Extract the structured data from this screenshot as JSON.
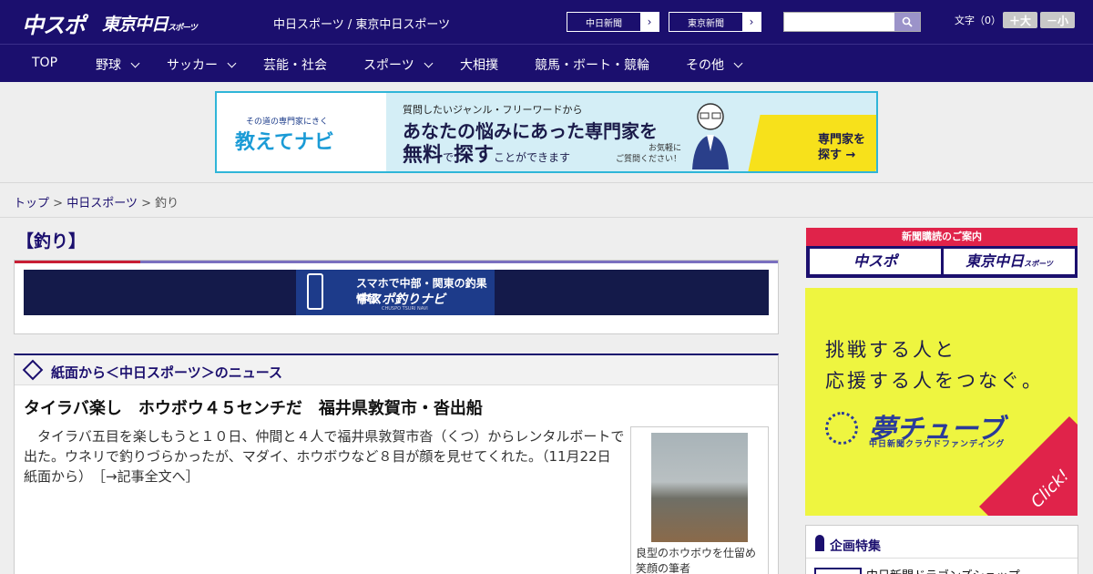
{
  "header": {
    "logo": "中スポ",
    "logo2": "東京中日",
    "logo2_suffix": "スポーツ",
    "tagline": "中日スポーツ / 東京中日スポーツ",
    "ext_links": [
      {
        "label": "中日新聞"
      },
      {
        "label": "東京新聞"
      }
    ],
    "search_placeholder": "",
    "fontsize_label": "文字（0）",
    "font_larger": "＋大",
    "font_smaller": "－小"
  },
  "nav": [
    {
      "label": "TOP",
      "has_menu": false
    },
    {
      "label": "野球",
      "has_menu": true
    },
    {
      "label": "サッカー",
      "has_menu": true
    },
    {
      "label": "芸能・社会",
      "has_menu": false
    },
    {
      "label": "スポーツ",
      "has_menu": true
    },
    {
      "label": "大相撲",
      "has_menu": false
    },
    {
      "label": "競馬・ボート・競輪",
      "has_menu": false
    },
    {
      "label": "その他",
      "has_menu": true
    }
  ],
  "top_ad": {
    "small": "その道の専門家にきく",
    "brand": "教えてナビ",
    "question": "質問したいジャンル・フリーワードから",
    "line1": "あなたの悩みにあった専門家を",
    "line2_a": "無料",
    "line2_b": "で",
    "line2_c": "探す",
    "line2_d": "ことができます",
    "note1": "お気軽に",
    "note2": "ご質問ください！",
    "cta1": "専門家を",
    "cta2": "探す →"
  },
  "breadcrumb": {
    "top": "トップ",
    "sep": ">",
    "section": "中日スポーツ",
    "current": "釣り"
  },
  "page_title": "【釣り】",
  "tsuri_ad": {
    "line1": "スマホで中部・関東の釣果情報",
    "line2": "中スポ釣りナビ",
    "line3": "CHUSPO TSURI NAVI"
  },
  "news": {
    "section_label": "紙面から＜中日スポーツ＞のニュース",
    "headline": "タイラバ楽し　ホウボウ４５センチだ　福井県敦賀市・沓出船",
    "body": "タイラバ五目を楽しもうと１０日、仲間と４人で福井県敦賀市沓（くつ）からレンタルボートで出た。ウネリで釣りづらかったが、マダイ、ホウボウなど８目が顔を見せてくれた。（11月22日 紙面から）",
    "more": "［→記事全文へ］",
    "caption": "良型のホウボウを仕留め笑顔の筆者"
  },
  "sidebar": {
    "subscribe_head": "新聞購読のご案内",
    "sub_btn1": "中スポ",
    "sub_btn2": "東京中日",
    "sub_btn2_suffix": "スポーツ",
    "yume_l1": "挑戦する人と",
    "yume_l2": "応援する人をつなぐ。",
    "yume_brand": "夢チューブ",
    "yume_sub": "中日新聞クラウドファンディング",
    "yume_click": "Click!",
    "kikaku_label": "企画特集",
    "kikaku_item": "中日新聞ドラゴンズショップ"
  },
  "colors": {
    "brand_navy": "#1b0f6e",
    "accent_red": "#e0234a",
    "yume_yellow": "#eef540"
  }
}
